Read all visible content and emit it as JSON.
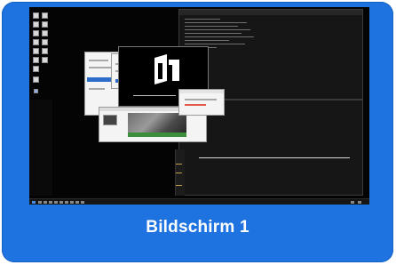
{
  "tile": {
    "label": "Bildschirm 1",
    "background_color": "#1f73e0",
    "label_color": "#ffffff"
  },
  "thumbnail": {
    "desktop_background": "#040404",
    "icons": [
      "app-icon"
    ]
  }
}
